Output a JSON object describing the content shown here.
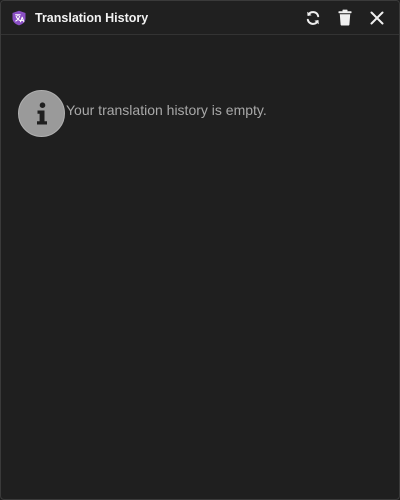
{
  "window": {
    "title": "Translation History",
    "app_icon": "shield-translate-logo-icon",
    "accent_color": "#8a4fc4"
  },
  "toolbar": {
    "refresh_icon": "refresh-icon",
    "delete_icon": "trash-icon",
    "close_icon": "close-icon"
  },
  "empty_state": {
    "icon": "info-icon",
    "message": "Your translation history is empty."
  }
}
